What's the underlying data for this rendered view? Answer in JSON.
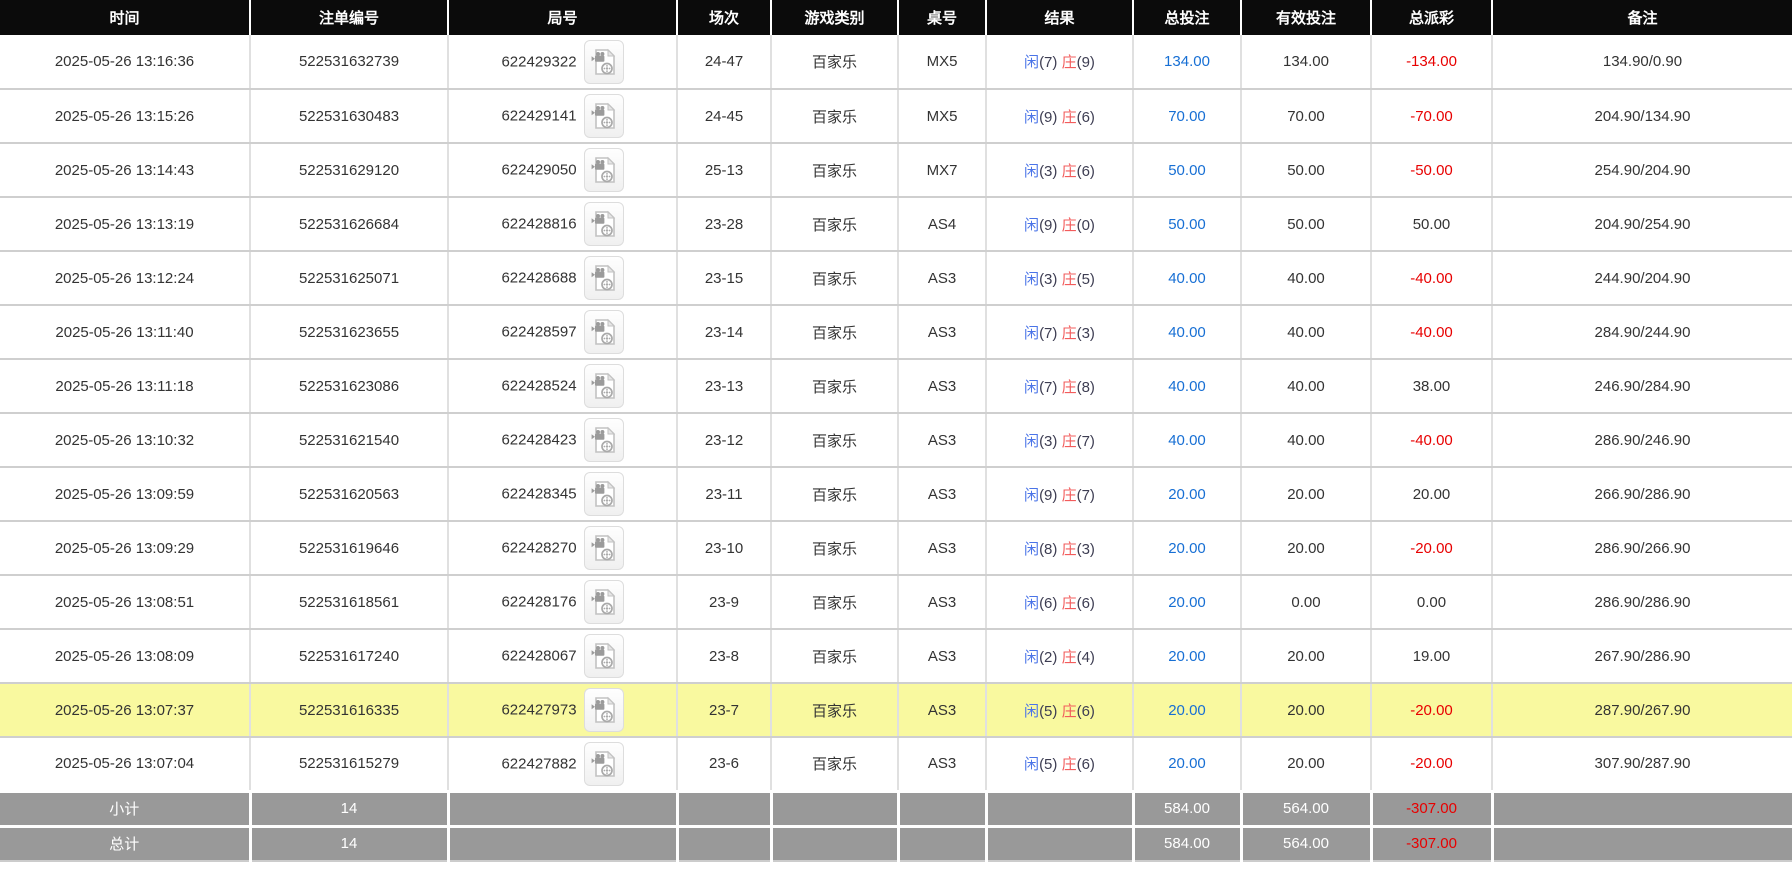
{
  "table": {
    "result_labels": {
      "player": "闲",
      "banker": "庄"
    },
    "columns": [
      {
        "key": "time",
        "label": "时间"
      },
      {
        "key": "bet_no",
        "label": "注单编号"
      },
      {
        "key": "round_no",
        "label": "局号"
      },
      {
        "key": "session",
        "label": "场次"
      },
      {
        "key": "game_type",
        "label": "游戏类别"
      },
      {
        "key": "table_no",
        "label": "桌号"
      },
      {
        "key": "result",
        "label": "结果"
      },
      {
        "key": "total_bet",
        "label": "总投注"
      },
      {
        "key": "valid_bet",
        "label": "有效投注"
      },
      {
        "key": "total_payout",
        "label": "总派彩"
      },
      {
        "key": "remark",
        "label": "备注"
      }
    ],
    "icons": {
      "round_video": "video-file-icon"
    },
    "colors": {
      "header_bg": "#0b0b0b",
      "totals_bg": "#999999",
      "highlight_yellow": "#f9f99f",
      "bet_blue": "#176fd4",
      "player_blue": "#4a74e8",
      "banker_red": "#f25c5c",
      "loss_red": "#e80000"
    },
    "rows": [
      {
        "time": "2025-05-26 13:16:36",
        "bet_no": "522531632739",
        "round_no": "622429322",
        "session": "24-47",
        "game_type": "百家乐",
        "table_no": "MX5",
        "player_pts": "(7)",
        "banker_pts": "(9)",
        "total_bet": "134.00",
        "valid_bet": "134.00",
        "total_payout": "-134.00",
        "remark": "134.90/0.90",
        "highlighted": false
      },
      {
        "time": "2025-05-26 13:15:26",
        "bet_no": "522531630483",
        "round_no": "622429141",
        "session": "24-45",
        "game_type": "百家乐",
        "table_no": "MX5",
        "player_pts": "(9)",
        "banker_pts": "(6)",
        "total_bet": "70.00",
        "valid_bet": "70.00",
        "total_payout": "-70.00",
        "remark": "204.90/134.90",
        "highlighted": false
      },
      {
        "time": "2025-05-26 13:14:43",
        "bet_no": "522531629120",
        "round_no": "622429050",
        "session": "25-13",
        "game_type": "百家乐",
        "table_no": "MX7",
        "player_pts": "(3)",
        "banker_pts": "(6)",
        "total_bet": "50.00",
        "valid_bet": "50.00",
        "total_payout": "-50.00",
        "remark": "254.90/204.90",
        "highlighted": false
      },
      {
        "time": "2025-05-26 13:13:19",
        "bet_no": "522531626684",
        "round_no": "622428816",
        "session": "23-28",
        "game_type": "百家乐",
        "table_no": "AS4",
        "player_pts": "(9)",
        "banker_pts": "(0)",
        "total_bet": "50.00",
        "valid_bet": "50.00",
        "total_payout": "50.00",
        "remark": "204.90/254.90",
        "highlighted": false
      },
      {
        "time": "2025-05-26 13:12:24",
        "bet_no": "522531625071",
        "round_no": "622428688",
        "session": "23-15",
        "game_type": "百家乐",
        "table_no": "AS3",
        "player_pts": "(3)",
        "banker_pts": "(5)",
        "total_bet": "40.00",
        "valid_bet": "40.00",
        "total_payout": "-40.00",
        "remark": "244.90/204.90",
        "highlighted": false
      },
      {
        "time": "2025-05-26 13:11:40",
        "bet_no": "522531623655",
        "round_no": "622428597",
        "session": "23-14",
        "game_type": "百家乐",
        "table_no": "AS3",
        "player_pts": "(7)",
        "banker_pts": "(3)",
        "total_bet": "40.00",
        "valid_bet": "40.00",
        "total_payout": "-40.00",
        "remark": "284.90/244.90",
        "highlighted": false
      },
      {
        "time": "2025-05-26 13:11:18",
        "bet_no": "522531623086",
        "round_no": "622428524",
        "session": "23-13",
        "game_type": "百家乐",
        "table_no": "AS3",
        "player_pts": "(7)",
        "banker_pts": "(8)",
        "total_bet": "40.00",
        "valid_bet": "40.00",
        "total_payout": "38.00",
        "remark": "246.90/284.90",
        "highlighted": false
      },
      {
        "time": "2025-05-26 13:10:32",
        "bet_no": "522531621540",
        "round_no": "622428423",
        "session": "23-12",
        "game_type": "百家乐",
        "table_no": "AS3",
        "player_pts": "(3)",
        "banker_pts": "(7)",
        "total_bet": "40.00",
        "valid_bet": "40.00",
        "total_payout": "-40.00",
        "remark": "286.90/246.90",
        "highlighted": false
      },
      {
        "time": "2025-05-26 13:09:59",
        "bet_no": "522531620563",
        "round_no": "622428345",
        "session": "23-11",
        "game_type": "百家乐",
        "table_no": "AS3",
        "player_pts": "(9)",
        "banker_pts": "(7)",
        "total_bet": "20.00",
        "valid_bet": "20.00",
        "total_payout": "20.00",
        "remark": "266.90/286.90",
        "highlighted": false
      },
      {
        "time": "2025-05-26 13:09:29",
        "bet_no": "522531619646",
        "round_no": "622428270",
        "session": "23-10",
        "game_type": "百家乐",
        "table_no": "AS3",
        "player_pts": "(8)",
        "banker_pts": "(3)",
        "total_bet": "20.00",
        "valid_bet": "20.00",
        "total_payout": "-20.00",
        "remark": "286.90/266.90",
        "highlighted": false
      },
      {
        "time": "2025-05-26 13:08:51",
        "bet_no": "522531618561",
        "round_no": "622428176",
        "session": "23-9",
        "game_type": "百家乐",
        "table_no": "AS3",
        "player_pts": "(6)",
        "banker_pts": "(6)",
        "total_bet": "20.00",
        "valid_bet": "0.00",
        "total_payout": "0.00",
        "remark": "286.90/286.90",
        "highlighted": false
      },
      {
        "time": "2025-05-26 13:08:09",
        "bet_no": "522531617240",
        "round_no": "622428067",
        "session": "23-8",
        "game_type": "百家乐",
        "table_no": "AS3",
        "player_pts": "(2)",
        "banker_pts": "(4)",
        "total_bet": "20.00",
        "valid_bet": "20.00",
        "total_payout": "19.00",
        "remark": "267.90/286.90",
        "highlighted": false
      },
      {
        "time": "2025-05-26 13:07:37",
        "bet_no": "522531616335",
        "round_no": "622427973",
        "session": "23-7",
        "game_type": "百家乐",
        "table_no": "AS3",
        "player_pts": "(5)",
        "banker_pts": "(6)",
        "total_bet": "20.00",
        "valid_bet": "20.00",
        "total_payout": "-20.00",
        "remark": "287.90/267.90",
        "highlighted": true
      },
      {
        "time": "2025-05-26 13:07:04",
        "bet_no": "522531615279",
        "round_no": "622427882",
        "session": "23-6",
        "game_type": "百家乐",
        "table_no": "AS3",
        "player_pts": "(5)",
        "banker_pts": "(6)",
        "total_bet": "20.00",
        "valid_bet": "20.00",
        "total_payout": "-20.00",
        "remark": "307.90/287.90",
        "highlighted": false
      }
    ],
    "totals": [
      {
        "label": "小计",
        "count": "14",
        "total_bet": "584.00",
        "valid_bet": "564.00",
        "total_payout": "-307.00"
      },
      {
        "label": "总计",
        "count": "14",
        "total_bet": "584.00",
        "valid_bet": "564.00",
        "total_payout": "-307.00"
      }
    ]
  }
}
